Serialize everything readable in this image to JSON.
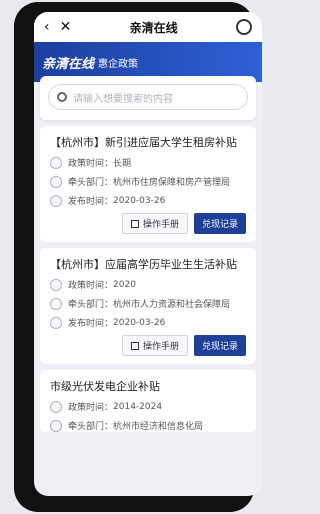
{
  "header": {
    "back_icon": "chevron-left-icon",
    "close_icon": "close-icon",
    "title": "亲清在线",
    "refresh_icon": "refresh-icon"
  },
  "brand": {
    "logo": "亲清在线",
    "subtitle": "惠企政策"
  },
  "search": {
    "placeholder": "请输入想要搜索的内容"
  },
  "cards": [
    {
      "title": "【杭州市】新引进应届大学生租房补贴",
      "period_label": "政策时间：",
      "period": "长期",
      "dept_label": "牵头部门：",
      "dept": "杭州市住房保障和房产管理局",
      "date_label": "发布时间：",
      "date": "2020-03-26",
      "manual_label": "操作手册",
      "redeem_label": "兑现记录"
    },
    {
      "title": "【杭州市】应届高学历毕业生生活补贴",
      "period_label": "政策时间：",
      "period": "2020",
      "dept_label": "牵头部门：",
      "dept": "杭州市人力资源和社会保障局",
      "date_label": "发布时间：",
      "date": "2020-03-26",
      "manual_label": "操作手册",
      "redeem_label": "兑现记录"
    },
    {
      "title": "市级光伏发电企业补贴",
      "period_label": "政策时间：",
      "period": "2014-2024",
      "dept_label": "牵头部门：",
      "dept": "杭州市经济和信息化局"
    }
  ]
}
